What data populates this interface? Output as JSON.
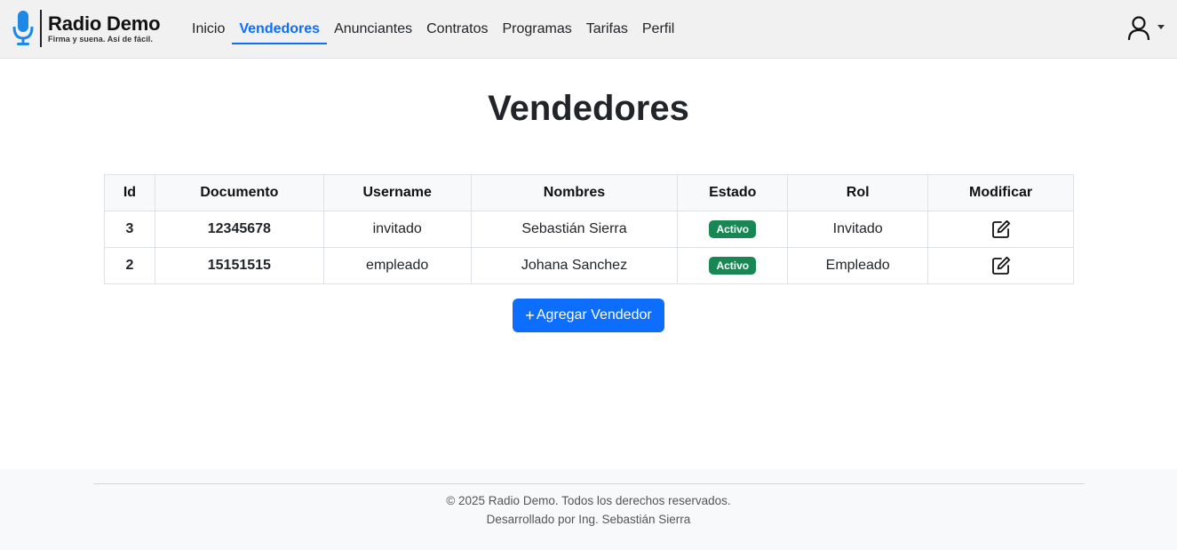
{
  "brand": {
    "name": "Radio Demo",
    "tagline": "Firma y suena. Así de fácil."
  },
  "nav": {
    "items": [
      {
        "label": "Inicio",
        "active": false
      },
      {
        "label": "Vendedores",
        "active": true
      },
      {
        "label": "Anunciantes",
        "active": false
      },
      {
        "label": "Contratos",
        "active": false
      },
      {
        "label": "Programas",
        "active": false
      },
      {
        "label": "Tarifas",
        "active": false
      },
      {
        "label": "Perfil",
        "active": false
      }
    ]
  },
  "page": {
    "title": "Vendedores"
  },
  "table": {
    "headers": [
      "Id",
      "Documento",
      "Username",
      "Nombres",
      "Estado",
      "Rol",
      "Modificar"
    ],
    "rows": [
      {
        "id": "3",
        "documento": "12345678",
        "username": "invitado",
        "nombres": "Sebastián Sierra",
        "estado": "Activo",
        "rol": "Invitado"
      },
      {
        "id": "2",
        "documento": "15151515",
        "username": "empleado",
        "nombres": "Johana Sanchez",
        "estado": "Activo",
        "rol": "Empleado"
      }
    ]
  },
  "actions": {
    "add_label": "Agregar Vendedor",
    "add_icon": "plus-icon",
    "edit_icon": "pencil-square-icon"
  },
  "footer": {
    "copyright": "© 2025 Radio Demo. Todos los derechos reservados.",
    "credits": "Desarrollado por Ing. Sebastián Sierra"
  },
  "colors": {
    "primary": "#0d6efd",
    "success": "#198754",
    "navbar_bg": "#f1f1f1",
    "brand_mic": "#1e88e5"
  }
}
